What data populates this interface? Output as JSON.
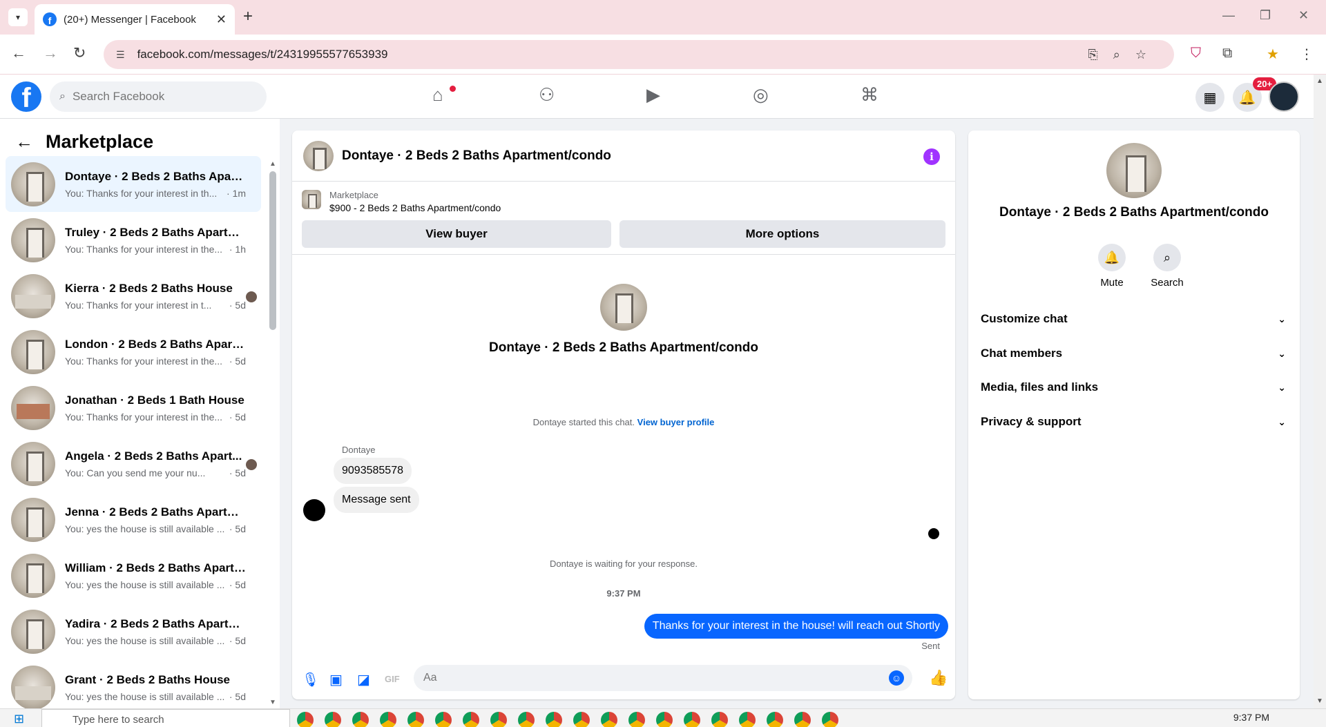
{
  "browser": {
    "tab_title": "(20+) Messenger | Facebook",
    "url": "facebook.com/messages/t/24319955577653939"
  },
  "fb": {
    "search_placeholder": "Search Facebook",
    "notif_badge": "20+"
  },
  "sidebar": {
    "title": "Marketplace",
    "conversations": [
      {
        "name": "Dontaye · 2 Beds 2 Baths Apart...",
        "preview": "You: Thanks for your interest in th...",
        "time": "· 1m",
        "active": true,
        "thumb": "apartment"
      },
      {
        "name": "Truley · 2 Beds 2 Baths Apartme...",
        "preview": "You: Thanks for your interest in the...",
        "time": "· 1h",
        "thumb": "apartment"
      },
      {
        "name": "Kierra · 2 Beds 2 Baths House",
        "preview": "You: Thanks for your interest in t...",
        "time": "· 5d",
        "thumb": "room",
        "seen": true
      },
      {
        "name": "London · 2 Beds 2 Baths Apartm...",
        "preview": "You: Thanks for your interest in the...",
        "time": "· 5d",
        "thumb": "apartment"
      },
      {
        "name": "Jonathan · 2 Beds 1 Bath House",
        "preview": "You: Thanks for your interest in the...",
        "time": "· 5d",
        "thumb": "house"
      },
      {
        "name": "Angela · 2 Beds 2 Baths Apart...",
        "preview": "You: Can you send me your nu...",
        "time": "· 5d",
        "thumb": "apartment",
        "seen": true
      },
      {
        "name": "Jenna · 2 Beds 2 Baths Apartme...",
        "preview": "You: yes the house is still available ...",
        "time": "· 5d",
        "thumb": "apartment"
      },
      {
        "name": "William · 2 Beds 2 Baths Apartm...",
        "preview": "You: yes the house is still available ...",
        "time": "· 5d",
        "thumb": "apartment"
      },
      {
        "name": "Yadira · 2 Beds 2 Baths Apartme...",
        "preview": "You: yes the house is still available ...",
        "time": "· 5d",
        "thumb": "apartment"
      },
      {
        "name": "Grant · 2 Beds 2 Baths House",
        "preview": "You: yes the house is still available ...",
        "time": "· 5d",
        "thumb": "room"
      }
    ]
  },
  "chat": {
    "header_name": "Dontaye · 2 Beds 2 Baths Apartment/condo",
    "listing_label": "Marketplace",
    "listing_price": "$900 - 2 Beds 2 Baths Apartment/condo",
    "view_buyer": "View buyer",
    "more_options": "More options",
    "center_name": "Dontaye · 2 Beds 2 Baths Apartment/condo",
    "started_text": "Dontaye started this chat.",
    "view_profile_link": "View buyer profile",
    "sender": "Dontaye",
    "msg1": "9093585578",
    "msg2": "Message sent",
    "waiting": "Dontaye is waiting for your response.",
    "timestamp": "9:37 PM",
    "outgoing": "Thanks for your interest in the house! will reach out Shortly",
    "sent_status": "Sent",
    "composer_placeholder": "Aa"
  },
  "info_panel": {
    "name": "Dontaye · 2 Beds 2 Baths Apartment/condo",
    "mute": "Mute",
    "search": "Search",
    "rows": [
      "Customize chat",
      "Chat members",
      "Media, files and links",
      "Privacy & support"
    ]
  },
  "taskbar": {
    "search_placeholder": "Type here to search",
    "clock": "9:37 PM"
  },
  "colors": {
    "fb_blue": "#1877f2",
    "messenger_blue": "#0866ff",
    "info_purple": "#a033ff",
    "tabstrip": "#f7dfe3"
  }
}
